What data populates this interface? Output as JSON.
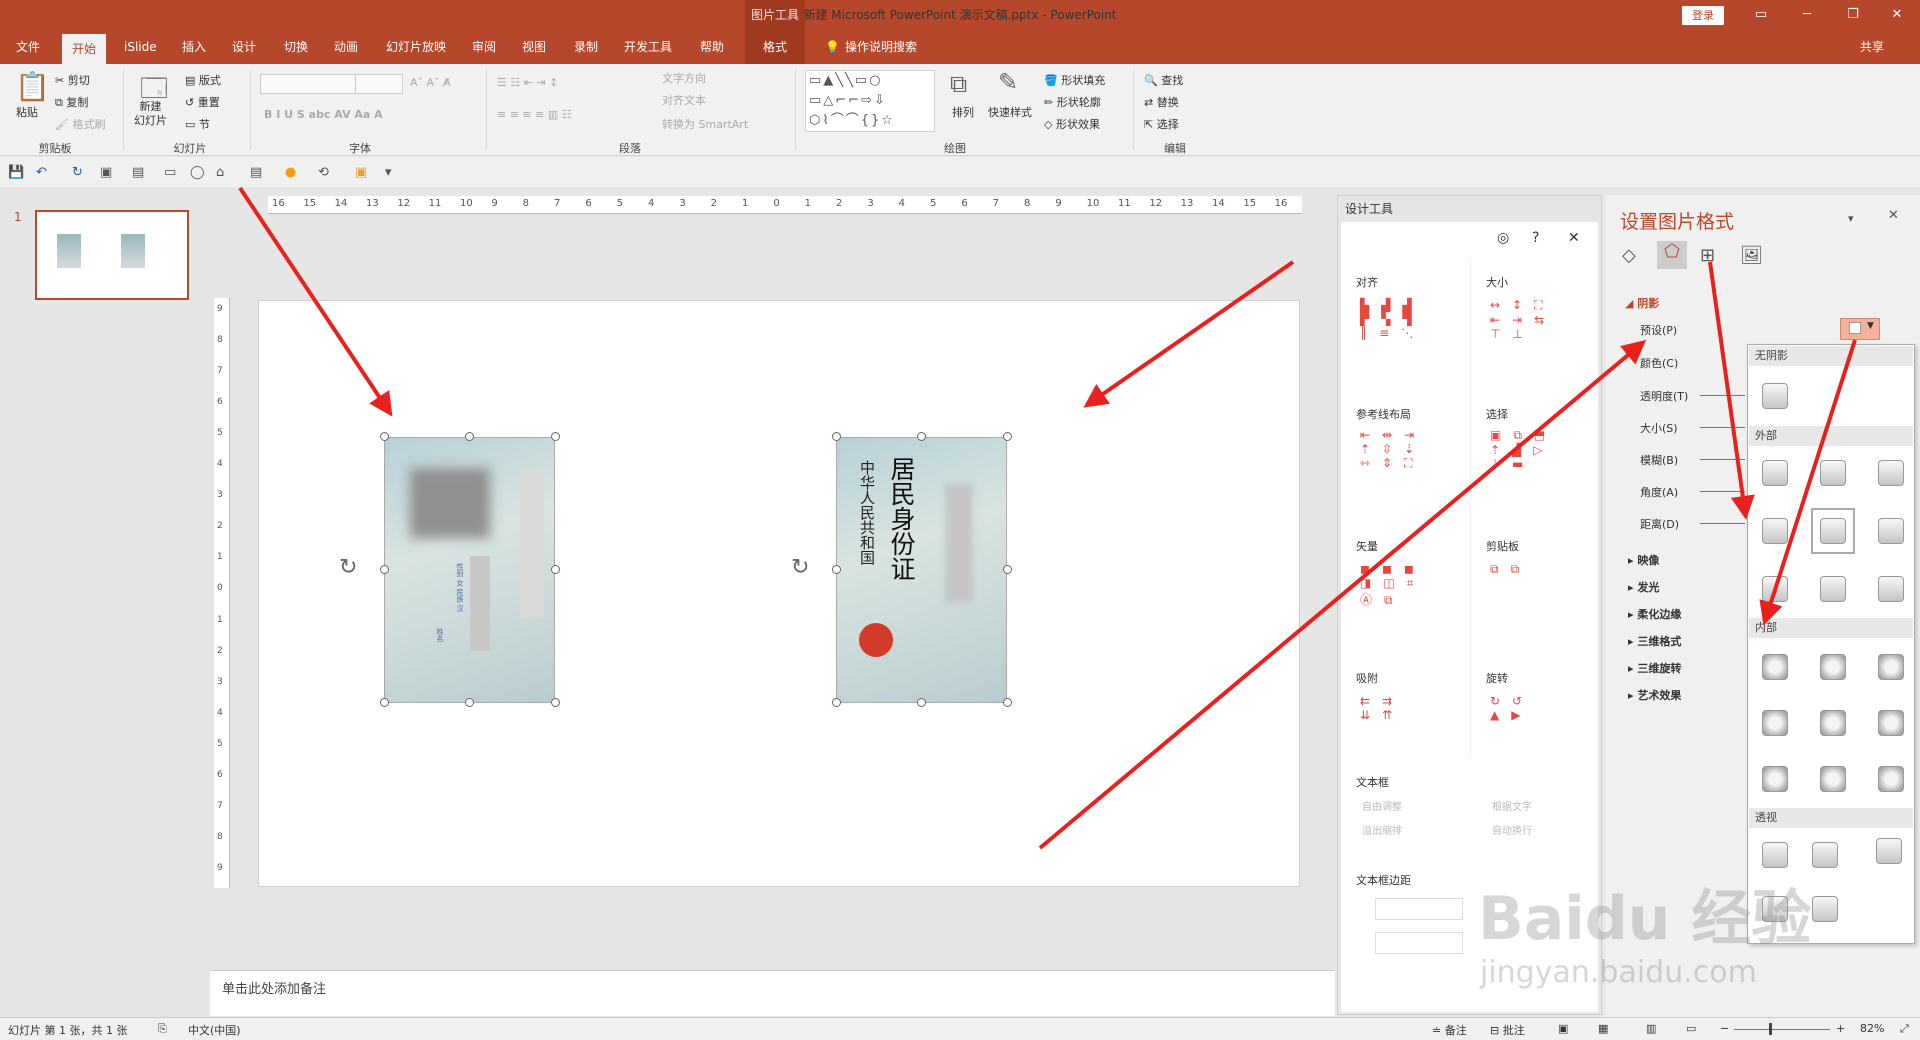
{
  "title": {
    "text": "新建 Microsoft PowerPoint 演示文稿.pptx  -  PowerPoint",
    "context": "图片工具",
    "login": "登录"
  },
  "tabs": [
    {
      "label": "文件"
    },
    {
      "label": "开始"
    },
    {
      "label": "iSlide"
    },
    {
      "label": "插入"
    },
    {
      "label": "设计"
    },
    {
      "label": "切换"
    },
    {
      "label": "动画"
    },
    {
      "label": "幻灯片放映"
    },
    {
      "label": "审阅"
    },
    {
      "label": "视图"
    },
    {
      "label": "录制"
    },
    {
      "label": "开发工具"
    },
    {
      "label": "帮助"
    },
    {
      "label": "格式"
    }
  ],
  "tell_me": "操作说明搜索",
  "share": "共享",
  "ribbon": {
    "clipboard": {
      "paste": "粘贴",
      "cut": "剪切",
      "copy": "复制",
      "format_painter": "格式刷",
      "label": "剪贴板"
    },
    "slides": {
      "new_slide": "新建\n幻灯片",
      "layout": "版式",
      "reset": "重置",
      "section": "节",
      "label": "幻灯片"
    },
    "font": {
      "label": "字体"
    },
    "paragraph": {
      "text_direction": "文字方向",
      "align_text": "对齐文本",
      "smartart": "转换为 SmartArt",
      "label": "段落"
    },
    "drawing": {
      "arrange": "排列",
      "quick_styles": "快速样式",
      "fill": "形状填充",
      "outline": "形状轮廓",
      "effects": "形状效果",
      "label": "绘图"
    },
    "editing": {
      "find": "查找",
      "replace": "替换",
      "select": "选择",
      "label": "编辑"
    }
  },
  "slides_panel": {
    "number": "1"
  },
  "notes": {
    "placeholder": "单击此处添加备注"
  },
  "ruler": {
    "h": [
      "16",
      "15",
      "14",
      "13",
      "12",
      "11",
      "10",
      "9",
      "8",
      "7",
      "6",
      "5",
      "4",
      "3",
      "2",
      "1",
      "0",
      "1",
      "2",
      "3",
      "4",
      "5",
      "6",
      "7",
      "8",
      "9",
      "10",
      "11",
      "12",
      "13",
      "14",
      "15",
      "16"
    ],
    "v": [
      "9",
      "8",
      "7",
      "6",
      "5",
      "4",
      "3",
      "2",
      "1",
      "0",
      "1",
      "2",
      "3",
      "4",
      "5",
      "6",
      "7",
      "8",
      "9"
    ]
  },
  "card_back": {
    "fields": [
      "姓名",
      "性别  女    民族 汉",
      "出生",
      "住址"
    ]
  },
  "card_front": {
    "title_top": "中华人民共和国",
    "title_main": "居民身份证"
  },
  "design_tools": {
    "title": "设计工具",
    "sections": {
      "align": "对齐",
      "size": "大小",
      "guide": "参考线布局",
      "select": "选择",
      "vector": "矢量",
      "clipboard": "剪贴板",
      "snap": "吸附",
      "rotate": "旋转",
      "textbox": "文本框",
      "textbox_margin": "文本框边距"
    },
    "textbox_opts": {
      "auto": "自由调整",
      "fit": "根据文字",
      "overflow": "溢出缩排",
      "wrap": "自动换行"
    }
  },
  "format_panel": {
    "title": "设置图片格式",
    "shadow": "阴影",
    "rows": {
      "preset": "预设(P)",
      "color": "颜色(C)",
      "transparency": "透明度(T)",
      "size": "大小(S)",
      "blur": "模糊(B)",
      "angle": "角度(A)",
      "distance": "距离(D)"
    },
    "sections": [
      "映像",
      "发光",
      "柔化边缘",
      "三维格式",
      "三维旋转",
      "艺术效果"
    ],
    "gallery": {
      "none": "无阴影",
      "outer": "外部",
      "inner": "内部",
      "perspective": "透视"
    }
  },
  "status": {
    "slide": "幻灯片 第 1 张，共 1 张",
    "lang": "中文(中国)",
    "notes": "备注",
    "comments": "批注",
    "zoom": "82%"
  },
  "watermark": {
    "brand": "Baidu 经验",
    "url": "jingyan.baidu.com"
  },
  "colors": {
    "accent": "#b7472a",
    "arrow": "#e8201e"
  }
}
